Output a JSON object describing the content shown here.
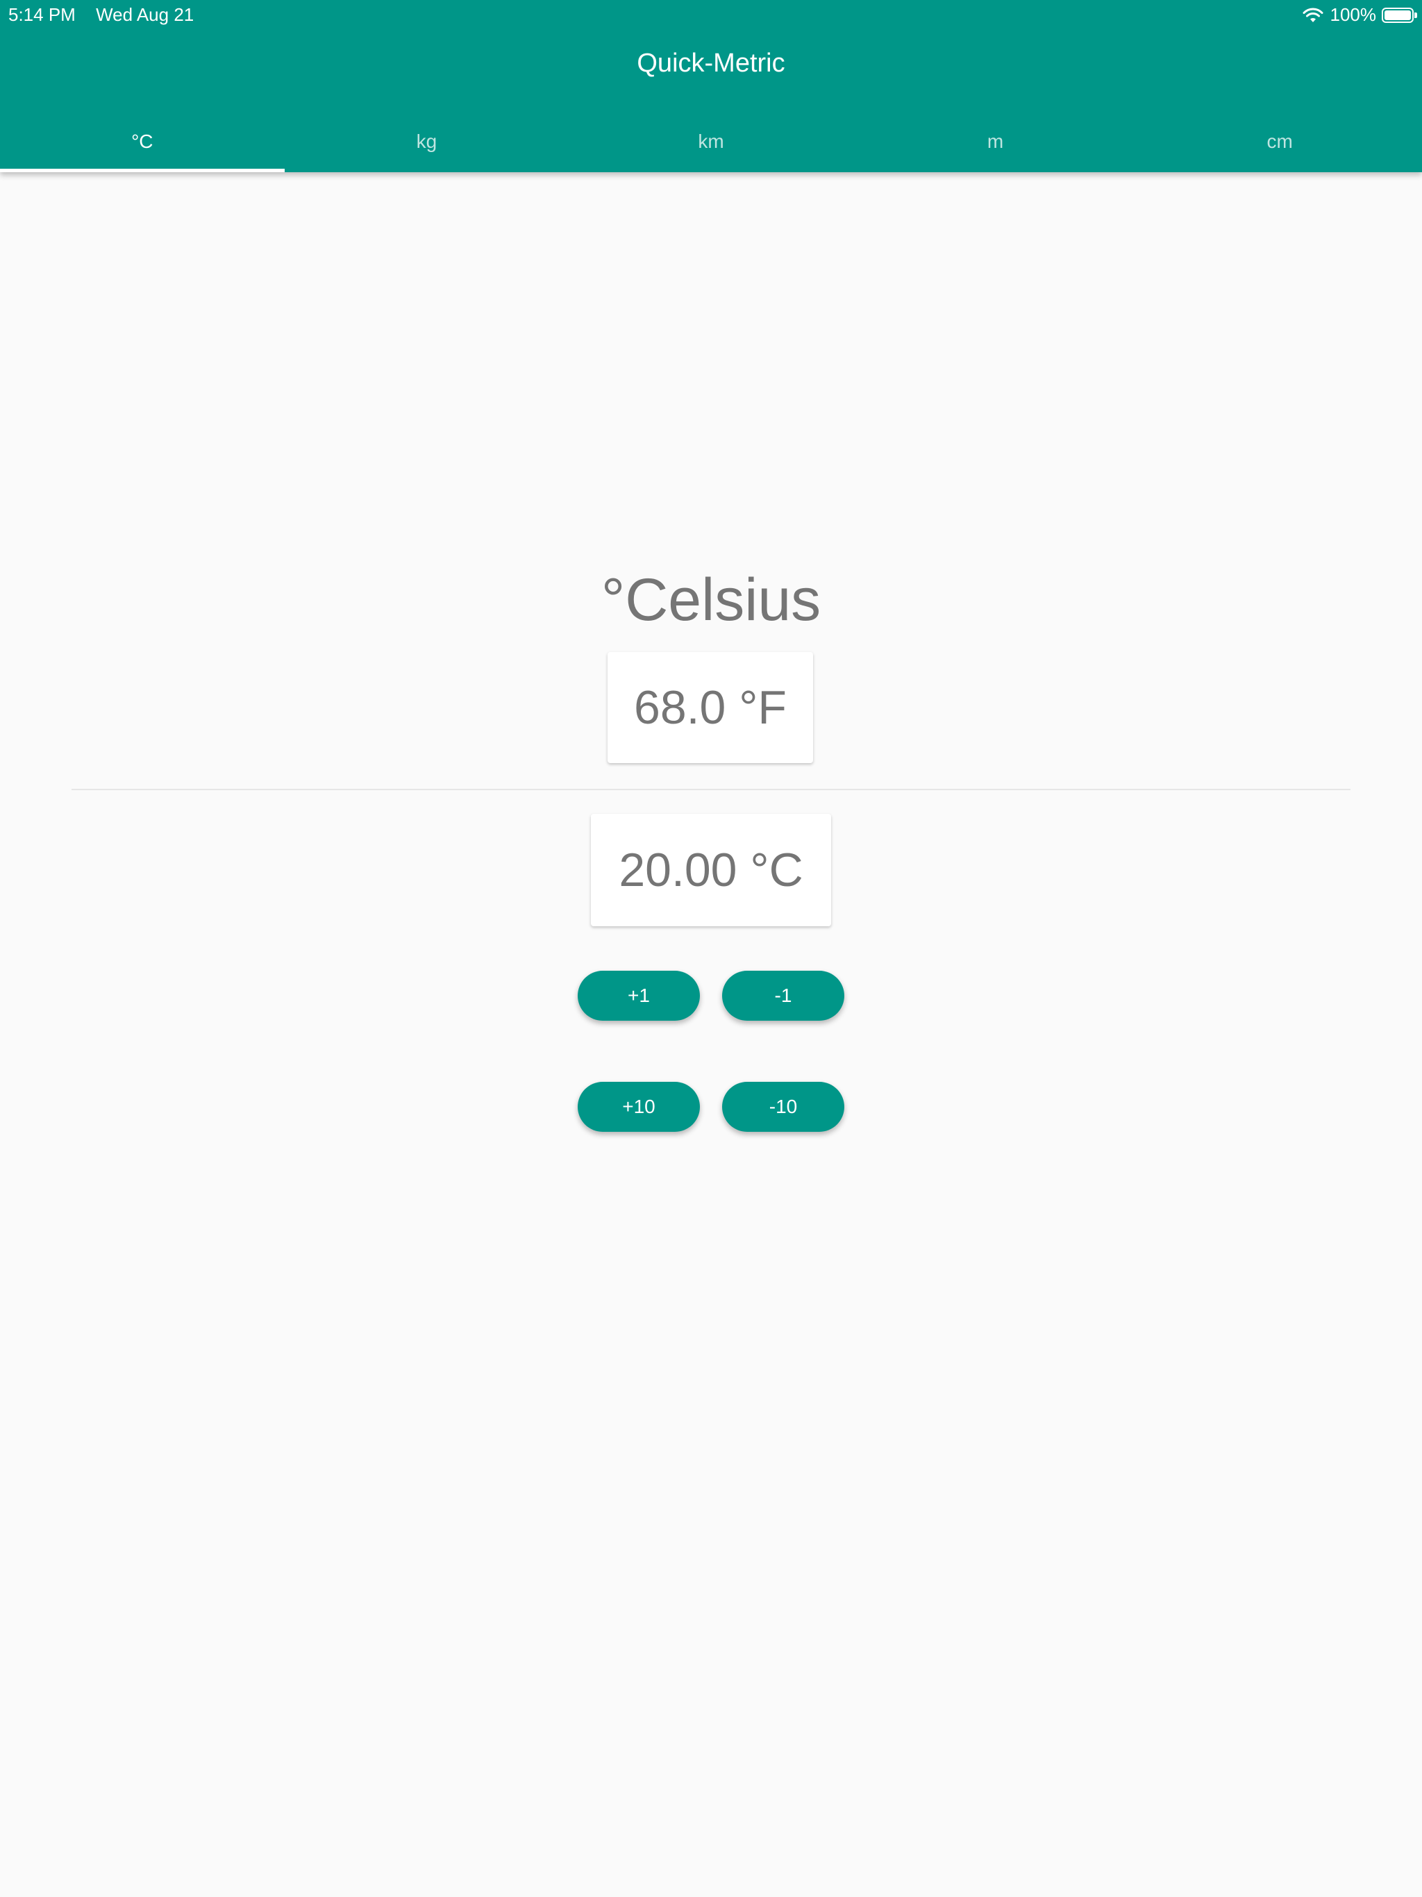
{
  "status_bar": {
    "time": "5:14 PM",
    "date": "Wed Aug 21",
    "battery": "100%",
    "wifi_icon": "wifi-icon",
    "battery_icon": "battery-icon"
  },
  "app": {
    "title": "Quick-Metric",
    "accent_color": "#009688"
  },
  "tabs": [
    {
      "label": "°C",
      "active": true
    },
    {
      "label": "kg",
      "active": false
    },
    {
      "label": "km",
      "active": false
    },
    {
      "label": "m",
      "active": false
    },
    {
      "label": "cm",
      "active": false
    }
  ],
  "converter": {
    "unit_title": "°Celsius",
    "fahrenheit_value": "68.0 °F",
    "celsius_value": "20.00 °C"
  },
  "buttons": {
    "plus_one": "+1",
    "minus_one": "-1",
    "plus_ten": "+10",
    "minus_ten": "-10"
  }
}
